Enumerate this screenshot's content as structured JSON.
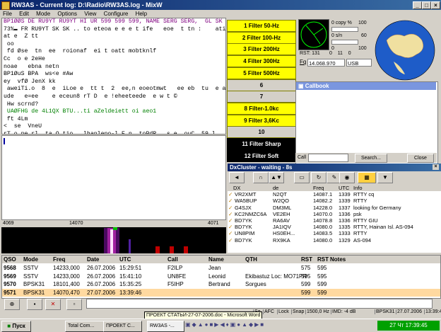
{
  "window": {
    "title": "RW3AS - Current log: D:\\Radio\\RW3AS.log - MixW",
    "min": "_",
    "max": "□",
    "close": "×"
  },
  "menu": [
    "File",
    "Edit",
    "Mode",
    "Options",
    "View",
    "Configure",
    "Help"
  ],
  "rx_lines": [
    {
      "text": "BP1ØØS DE RU9YT RU9YT HI UR 599 599 599, NAME SERG SERG,  GL SK",
      "color": "#800080"
    },
    {
      "text": "73%▬ FR RU9YT SK SK .. to eteoa e e e t ife   eoe  t tn :    atiD ePtetu n e( t",
      "color": "#000"
    },
    {
      "text": "at e  Z tt",
      "color": "#000"
    },
    {
      "text": " oo",
      "color": "#000"
    },
    {
      "text": " fd Øse  tn  ee  roionaf  ei t oatt mobtknlf",
      "color": "#000"
    },
    {
      "text": "Cc  o e 2eHe",
      "color": "#000"
    },
    {
      "text": "noae   ebna netn",
      "color": "#000"
    },
    {
      "text": "BP1ØuS BPA  ws<e #Aw",
      "color": "#000"
    },
    {
      "text": "ey  vfØ JenX kk",
      "color": "#000"
    },
    {
      "text": " aweiTi.o  8  e  iLoe e  tt t  2  ee,n eoeotmwt   ee eb  tu  e a ie neQ ht the",
      "color": "#000"
    },
    {
      "text": "ude   e=ee    e eceun8 rT D  e !eheeteede  e w t ©",
      "color": "#000"
    },
    {
      "text": " Hw scrnd?",
      "color": "#000"
    },
    {
      "text": " UAØFHG de 4L1QX BTU...ti aZeldeiett oi aeo1",
      "color": "#008000"
    },
    {
      "text": " ft 4Lm",
      "color": "#000"
    },
    {
      "text": "<  se  VneU",
      "color": "#000"
    },
    {
      "text": "rT o pe rl  ta O tio . lhanleno-l E n  toPdR.  s e  ouC  59 l   sketoD - eF o",
      "color": "#000"
    }
  ],
  "filters": [
    {
      "label": "1  Filter 50-Hz",
      "style": "fy"
    },
    {
      "label": "2  Filter 100-Hz",
      "style": "fy"
    },
    {
      "label": "3  Filter 200Hz",
      "style": "fy"
    },
    {
      "label": "4  Filter 300Hz",
      "style": "fy"
    },
    {
      "label": "5  Filter 500Hz",
      "style": "fy"
    },
    {
      "label": "6",
      "style": "fg"
    },
    {
      "label": "7",
      "style": "fg"
    },
    {
      "label": "8  Filter-1.0kc",
      "style": "fy"
    },
    {
      "label": "9 Filter 3,6Kc",
      "style": "fy"
    },
    {
      "label": "10",
      "style": "fg"
    },
    {
      "label": "11 Filter Sharp",
      "style": "fb"
    },
    {
      "label": "12 Filter Soft",
      "style": "fb"
    }
  ],
  "meter": {
    "copy_label": "0   copy %",
    "copy_val": "100",
    "sn_label": "0   s/n",
    "sn_val": "60",
    "zero_label": "0",
    "zero_val": "100"
  },
  "rst": "RST: 131",
  "rst_vals": [
    "0",
    "11",
    "0"
  ],
  "freq": {
    "label": "Fq",
    "value": "14.068.970",
    "mode": "USB"
  },
  "callbook": {
    "title": "Callbook",
    "call_label": "Call",
    "search": "Search...",
    "close": "Close"
  },
  "dxcluster": {
    "title": "DxCluster - waiting - 8s",
    "headers": [
      "DX",
      "de",
      "Freq",
      "UTC",
      "Info"
    ],
    "rows": [
      {
        "dx": "VR2XMT",
        "de": "N2QT",
        "freq": "14087.1",
        "utc": "1339",
        "info": "RTTY cq"
      },
      {
        "dx": "WA5BUP",
        "de": "W2QO",
        "freq": "14082.2",
        "utc": "1339",
        "info": "RTTY"
      },
      {
        "dx": "G4SJX",
        "de": "DM3ML",
        "freq": "14228.0",
        "utc": "1337",
        "info": "looking for Germany"
      },
      {
        "dx": "KC2NMZC6A",
        "de": "VE2EH",
        "freq": "14070.0",
        "utc": "1336",
        "info": "psk"
      },
      {
        "dx": "BD7YK",
        "de": "RA6AV",
        "freq": "14078.8",
        "utc": "1336",
        "info": "RTTY GIU"
      },
      {
        "dx": "BD7YK",
        "de": "JA1IQV",
        "freq": "14080.0",
        "utc": "1335",
        "info": "RTTY, Hainan Isl. AS-094"
      },
      {
        "dx": "UN8PIM",
        "de": "HS0EH...",
        "freq": "14083.5",
        "utc": "1333",
        "info": "RTTY"
      },
      {
        "dx": "BD7YK",
        "de": "RX9KA",
        "freq": "14080.0",
        "utc": "1329",
        "info": "AS-094"
      }
    ]
  },
  "ruler": {
    "left": "4069",
    "mid": "14070",
    "right": "4071"
  },
  "log": {
    "headers": [
      "QSO",
      "Mode",
      "Freq",
      "Date",
      "UTC",
      "Call",
      "Name",
      "QTH",
      "RST",
      "RST",
      "Notes"
    ],
    "rows": [
      [
        "9568",
        "SSTV",
        "14233,000",
        "26.07.2006",
        "15:29:51",
        "F2ILP",
        "Jean",
        "",
        "575",
        "595",
        ""
      ],
      [
        "9569",
        "SSTV",
        "14233,000",
        "26.07.2006",
        "15:41:10",
        "UN8FE",
        "Leonid",
        "Ekibastuz Loc: MO71PR",
        "595",
        "595",
        ""
      ],
      [
        "9570",
        "BPSK31",
        "18101,400",
        "26.07.2006",
        "15:35:25",
        "F5IHP",
        "Bertrand",
        "Sorgues",
        "599",
        "599",
        ""
      ],
      [
        "9571",
        "BPSK31",
        "14070,470",
        "27.07.2006",
        "13:39:46",
        "",
        "",
        "",
        "599",
        "599",
        ""
      ]
    ]
  },
  "status": {
    "items": [
      "Sq",
      "AFC",
      "Lock",
      "Snap",
      "1500,0 Hz",
      "IMD: -4 dB",
      "",
      "BPSK31",
      "27.07.2006",
      "13:39:46 z"
    ]
  },
  "tooltip": "ПРОЕКТ СТАТЬИ-27-07-2006.doc - Microsoft Word",
  "taskbar": {
    "start": "Пуск",
    "tasks": [
      "Total Com...",
      "ПРОЕКТ С...",
      "RW3AS -..."
    ],
    "clock": "27 Чт 17:39:45"
  }
}
